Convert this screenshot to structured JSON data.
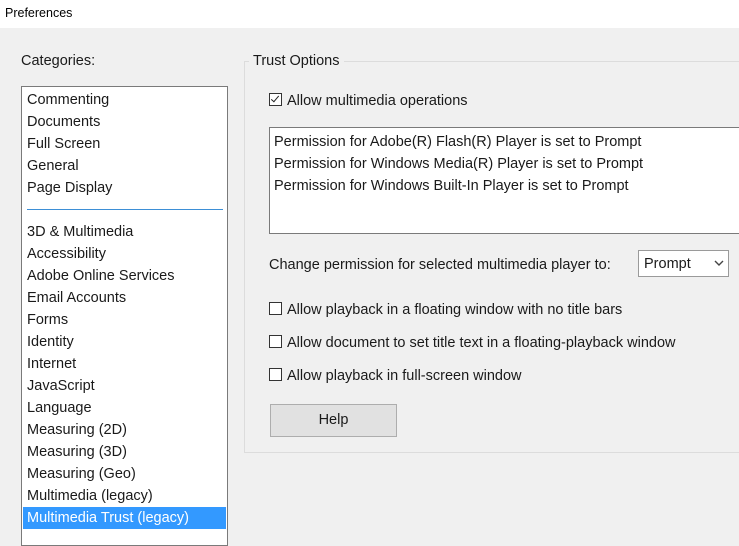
{
  "window": {
    "title": "Preferences"
  },
  "categories": {
    "label": "Categories:",
    "items": [
      "Commenting",
      "Documents",
      "Full Screen",
      "General",
      "Page Display",
      "3D & Multimedia",
      "Accessibility",
      "Adobe Online Services",
      "Email Accounts",
      "Forms",
      "Identity",
      "Internet",
      "JavaScript",
      "Language",
      "Measuring (2D)",
      "Measuring (3D)",
      "Measuring (Geo)",
      "Multimedia (legacy)",
      "Multimedia Trust (legacy)"
    ],
    "selected": "Multimedia Trust (legacy)"
  },
  "trust_options": {
    "title": "Trust Options",
    "allow_multimedia": {
      "label": "Allow multimedia operations",
      "checked": true
    },
    "permissions": [
      "Permission for Adobe(R) Flash(R) Player is set to Prompt",
      "Permission for Windows Media(R) Player is set to Prompt",
      "Permission for Windows Built-In Player is set to Prompt"
    ],
    "change_permission_label": "Change permission for selected multimedia player to:",
    "permission_select_value": "Prompt",
    "options": [
      {
        "label": "Allow playback in a floating window with no title bars",
        "checked": false
      },
      {
        "label": "Allow document to set title text in a floating-playback window",
        "checked": false
      },
      {
        "label": "Allow playback in full-screen window",
        "checked": false
      }
    ],
    "help_label": "Help"
  },
  "colors": {
    "selection": "#3399ff",
    "separator": "#3d8fd6"
  }
}
